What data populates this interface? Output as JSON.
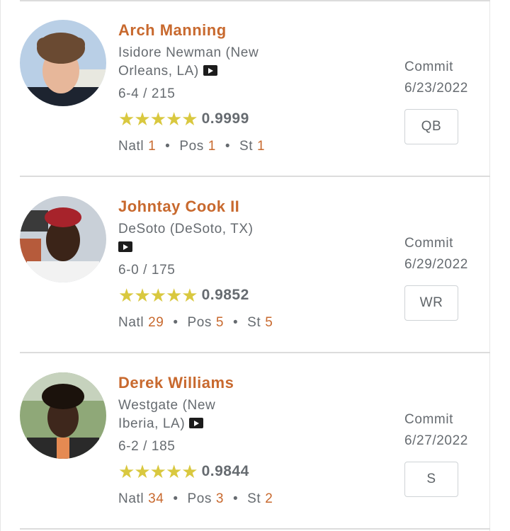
{
  "players": [
    {
      "name": "Arch Manning",
      "school_line1": "Isidore Newman (New",
      "school_line2": "Orleans, LA)",
      "height_weight": "6-4 / 215",
      "rating": "0.9999",
      "stars": 5,
      "natl_label": "Natl",
      "natl": "1",
      "pos_label": "Pos",
      "pos_rank": "1",
      "st_label": "St",
      "st": "1",
      "status": "Commit",
      "date": "6/23/2022",
      "position": "QB"
    },
    {
      "name": "Johntay Cook II",
      "school_line1": "DeSoto (DeSoto, TX)",
      "school_line2": "",
      "height_weight": "6-0 / 175",
      "rating": "0.9852",
      "stars": 5,
      "natl_label": "Natl",
      "natl": "29",
      "pos_label": "Pos",
      "pos_rank": "5",
      "st_label": "St",
      "st": "5",
      "status": "Commit",
      "date": "6/29/2022",
      "position": "WR"
    },
    {
      "name": "Derek Williams",
      "school_line1": "Westgate (New",
      "school_line2": "Iberia, LA)",
      "height_weight": "6-2 / 185",
      "rating": "0.9844",
      "stars": 5,
      "natl_label": "Natl",
      "natl": "34",
      "pos_label": "Pos",
      "pos_rank": "3",
      "st_label": "St",
      "st": "2",
      "status": "Commit",
      "date": "6/27/2022",
      "position": "S"
    }
  ],
  "icons": {
    "video": "video-play-icon",
    "star": "star-icon",
    "avatar": "player-photo"
  },
  "colors": {
    "name": "#c8692e",
    "rank_number": "#c8692e",
    "star": "#d9c83f",
    "text": "#666b70"
  }
}
